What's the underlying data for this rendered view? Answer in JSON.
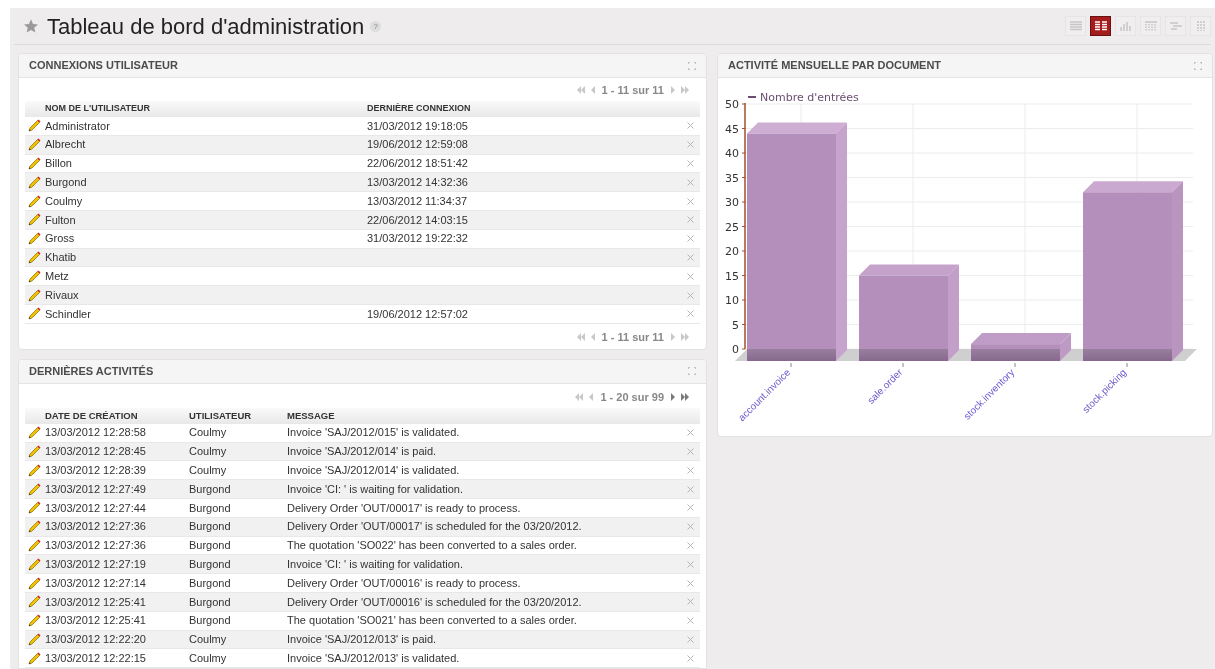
{
  "header": {
    "title": "Tableau de bord d'administration",
    "help": "?"
  },
  "view_switcher": [
    {
      "kind": "list",
      "selected": false
    },
    {
      "kind": "form",
      "selected": true
    },
    {
      "kind": "graph",
      "selected": false
    },
    {
      "kind": "calendar",
      "selected": false
    },
    {
      "kind": "gantt",
      "selected": false
    },
    {
      "kind": "kanban",
      "selected": false
    }
  ],
  "user_logins": {
    "title": "CONNEXIONS UTILISATEUR",
    "pager_top": {
      "label": "1 - 11 sur 11",
      "buttons": [
        {
          "kind": "first",
          "disabled": true
        },
        {
          "kind": "prev",
          "disabled": true
        },
        {
          "kind": "next",
          "disabled": true
        },
        {
          "kind": "last",
          "disabled": true
        }
      ]
    },
    "columns": [
      "NOM DE L'UTILISATEUR",
      "DERNIÈRE CONNEXION"
    ],
    "rows": [
      {
        "name": "Administrator",
        "last_login": "31/03/2012 19:18:05"
      },
      {
        "name": "Albrecht",
        "last_login": "19/06/2012 12:59:08"
      },
      {
        "name": "Billon",
        "last_login": "22/06/2012 18:51:42"
      },
      {
        "name": "Burgond",
        "last_login": "13/03/2012 14:32:36"
      },
      {
        "name": "Coulmy",
        "last_login": "13/03/2012 11:34:37"
      },
      {
        "name": "Fulton",
        "last_login": "22/06/2012 14:03:15"
      },
      {
        "name": "Gross",
        "last_login": "31/03/2012 19:22:32"
      },
      {
        "name": "Khatib"
      },
      {
        "name": "Metz"
      },
      {
        "name": "Rivaux"
      },
      {
        "name": "Schindler",
        "last_login": "19/06/2012 12:57:02"
      }
    ],
    "pager_bottom": {
      "label": "1 - 11 sur 11",
      "buttons": [
        {
          "kind": "first",
          "disabled": true
        },
        {
          "kind": "prev",
          "disabled": true
        },
        {
          "kind": "next",
          "disabled": true
        },
        {
          "kind": "last",
          "disabled": true
        }
      ]
    }
  },
  "recent_activity": {
    "title": "DERNIÈRES ACTIVITÉS",
    "pager_top": {
      "label": "1 - 20 sur 99",
      "buttons": [
        {
          "kind": "first",
          "disabled": true
        },
        {
          "kind": "prev",
          "disabled": true
        },
        {
          "kind": "next",
          "disabled": false
        },
        {
          "kind": "last",
          "disabled": false
        }
      ]
    },
    "columns": [
      "DATE DE CRÉATION",
      "UTILISATEUR",
      "MESSAGE"
    ],
    "rows": [
      {
        "date": "13/03/2012 12:28:58",
        "user": "Coulmy",
        "message": "Invoice 'SAJ/2012/015' is validated."
      },
      {
        "date": "13/03/2012 12:28:45",
        "user": "Coulmy",
        "message": "Invoice 'SAJ/2012/014' is paid."
      },
      {
        "date": "13/03/2012 12:28:39",
        "user": "Coulmy",
        "message": "Invoice 'SAJ/2012/014' is validated."
      },
      {
        "date": "13/03/2012 12:27:49",
        "user": "Burgond",
        "message": "Invoice 'CI: ' is waiting for validation."
      },
      {
        "date": "13/03/2012 12:27:44",
        "user": "Burgond",
        "message": "Delivery Order 'OUT/00017' is ready to process."
      },
      {
        "date": "13/03/2012 12:27:36",
        "user": "Burgond",
        "message": "Delivery Order 'OUT/00017' is scheduled for the 03/20/2012."
      },
      {
        "date": "13/03/2012 12:27:36",
        "user": "Burgond",
        "message": "The quotation 'SO022' has been converted to a sales order."
      },
      {
        "date": "13/03/2012 12:27:19",
        "user": "Burgond",
        "message": "Invoice 'CI: ' is waiting for validation."
      },
      {
        "date": "13/03/2012 12:27:14",
        "user": "Burgond",
        "message": "Delivery Order 'OUT/00016' is ready to process."
      },
      {
        "date": "13/03/2012 12:25:41",
        "user": "Burgond",
        "message": "Delivery Order 'OUT/00016' is scheduled for the 03/20/2012."
      },
      {
        "date": "13/03/2012 12:25:41",
        "user": "Burgond",
        "message": "The quotation 'SO021' has been converted to a sales order."
      },
      {
        "date": "13/03/2012 12:22:20",
        "user": "Coulmy",
        "message": "Invoice 'SAJ/2012/013' is paid."
      },
      {
        "date": "13/03/2012 12:22:15",
        "user": "Coulmy",
        "message": "Invoice 'SAJ/2012/013' is validated."
      }
    ]
  },
  "monthly_activity": {
    "title": "ACTIVITÉ MENSUELLE PAR DOCUMENT",
    "chart_data": {
      "type": "bar",
      "categories": [
        "account.invoice",
        "sale.order",
        "stock.inventory",
        "stock.picking"
      ],
      "series": [
        {
          "name": "Nombre d'entrées",
          "color": "#b58fbb",
          "values": [
            44,
            15,
            1,
            32
          ]
        }
      ],
      "ylim": [
        0,
        50
      ],
      "grid": true,
      "yticks": [
        0,
        5,
        10,
        15,
        20,
        25,
        30,
        35,
        40,
        45,
        50
      ]
    }
  }
}
